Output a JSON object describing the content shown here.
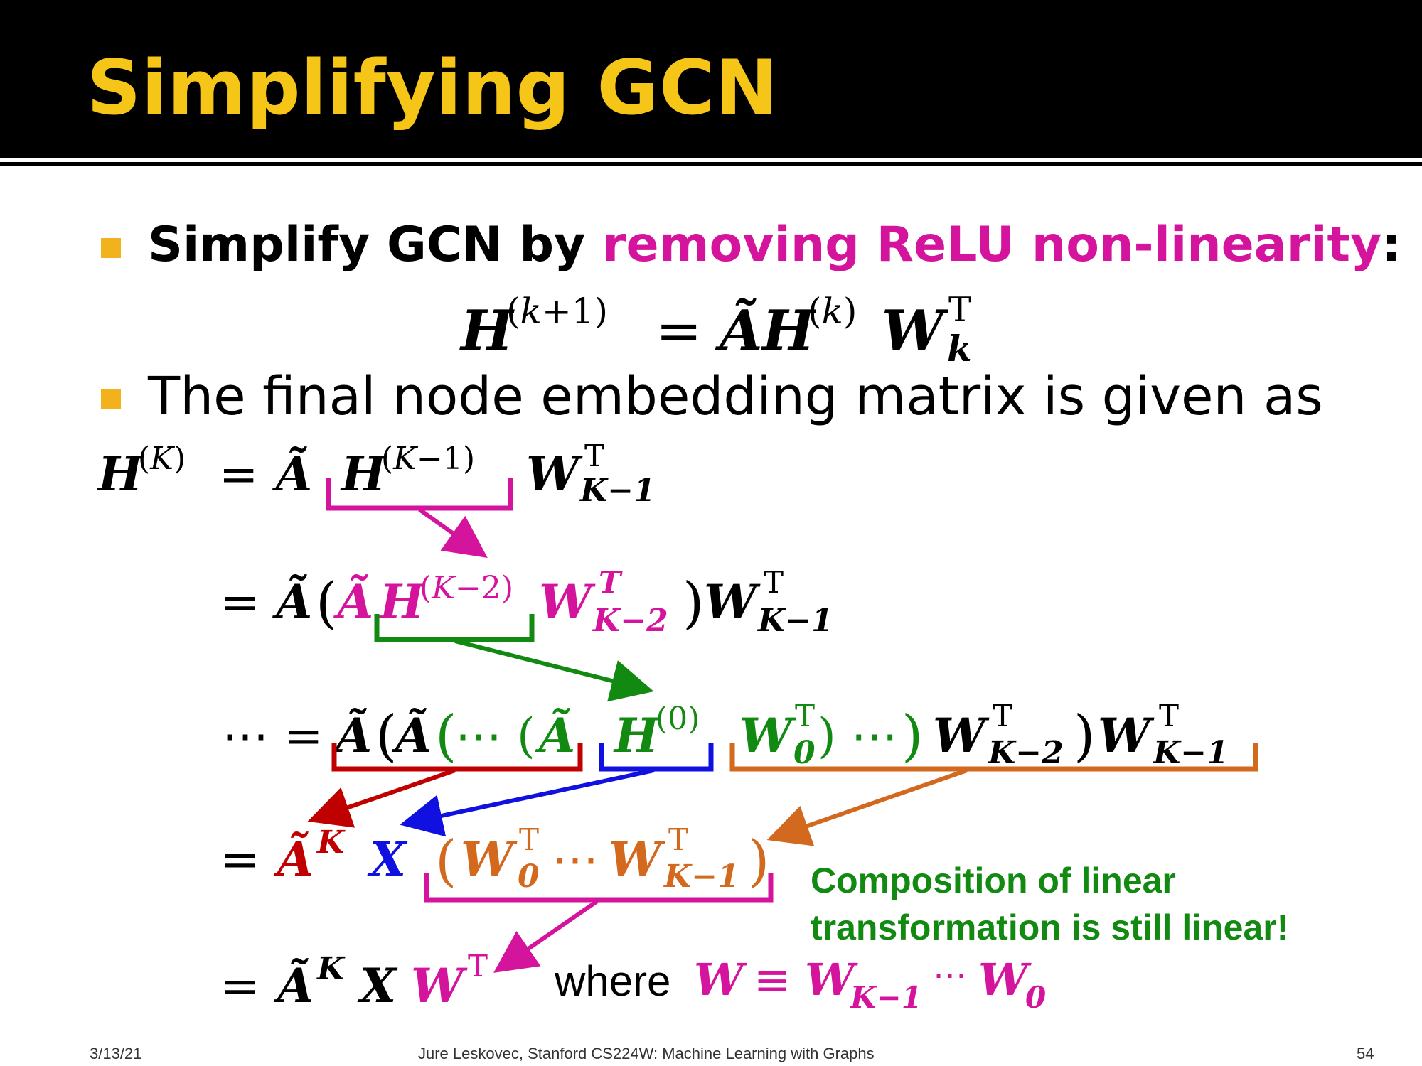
{
  "slide": {
    "title": "Simplifying GCN",
    "bullet1": {
      "lead": "Simplify GCN by ",
      "highlight": "removing ReLU non-linearity",
      "tail": ":"
    },
    "bullet2": "The final node embedding matrix is given as",
    "note_line1": "Composition of linear",
    "note_line2": "transformation is still linear!",
    "where_label": "where",
    "footer": {
      "date": "3/13/21",
      "credit": "Jure Leskovec, Stanford CS224W: Machine Learning with Graphs",
      "page": "54"
    }
  },
  "colors": {
    "title": "#f5c518",
    "bullet": "#f2b21b",
    "magenta": "#d4149c",
    "green": "#128a12",
    "red": "#c00000",
    "blue": "#1010e0",
    "orange": "#d2691e"
  },
  "math": {
    "update_rule": "H^(k+1) = Ã H^(k) W_k^T",
    "line1": "H^(K) = Ã H^(K−1) W_(K−1)^T",
    "line2": "= Ã(Ã H^(K−2) W_(K−2)^T) W_(K−1)^T",
    "line3": "⋯ = Ã(Ã(⋯(Ã H^(0) W_0^T)⋯) W_(K−2)^T) W_(K−1)^T",
    "line4": "= Ã^K X (W_0^T ⋯ W_(K−1)^T)",
    "line5": "= Ã^K X W^T",
    "where_def": "W ≡ W_(K−1) ⋯ W_0"
  }
}
